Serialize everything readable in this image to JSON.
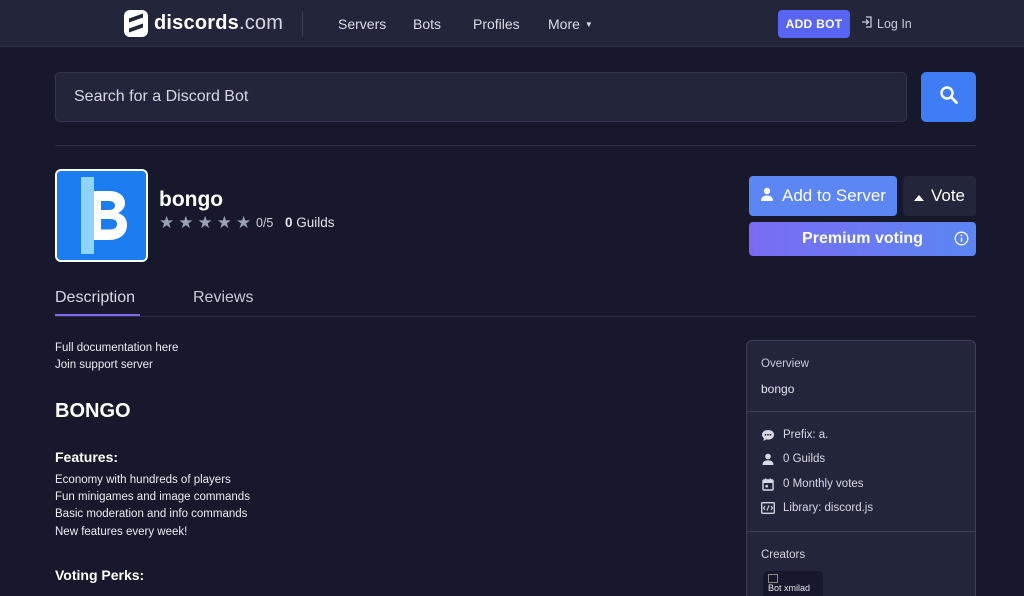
{
  "nav": {
    "logo_main": "discords",
    "logo_tld": ".com",
    "links": [
      "Servers",
      "Bots",
      "Profiles",
      "More"
    ],
    "add_bot": "ADD BOT",
    "login": "Log In"
  },
  "search": {
    "placeholder": "Search for a Discord Bot"
  },
  "bot": {
    "name": "bongo",
    "rating": "0/5",
    "rating_value": 0,
    "rating_max": 5,
    "guilds_number": "0",
    "guilds_word": "Guilds",
    "add_to_server": "Add to Server",
    "vote": "Vote",
    "premium_voting": "Premium voting"
  },
  "tabs": [
    "Description",
    "Reviews"
  ],
  "description": {
    "links": [
      "Full documentation here",
      "Join support server"
    ],
    "heading": "BONGO",
    "features_heading": "Features:",
    "features": [
      "Economy with hundreds of players",
      "Fun minigames and image commands",
      "Basic moderation and info commands",
      "New features every week!"
    ],
    "perks_heading": "Voting Perks:"
  },
  "overview": {
    "title": "Overview",
    "bot_name": "bongo",
    "prefix": "Prefix: a.",
    "guilds": "0 Guilds",
    "monthly_votes": "0 Monthly votes",
    "library": "Library: discord.js",
    "creators_title": "Creators",
    "creator_alt": "Bot",
    "creator_name": "xmilad"
  },
  "colors": {
    "background": "#17182b",
    "navbar": "#23253b",
    "accent_blue": "#5b86f3",
    "search_button": "#3f7df5",
    "add_bot": "#5865f2",
    "tab_underline": "#7b68ee"
  }
}
